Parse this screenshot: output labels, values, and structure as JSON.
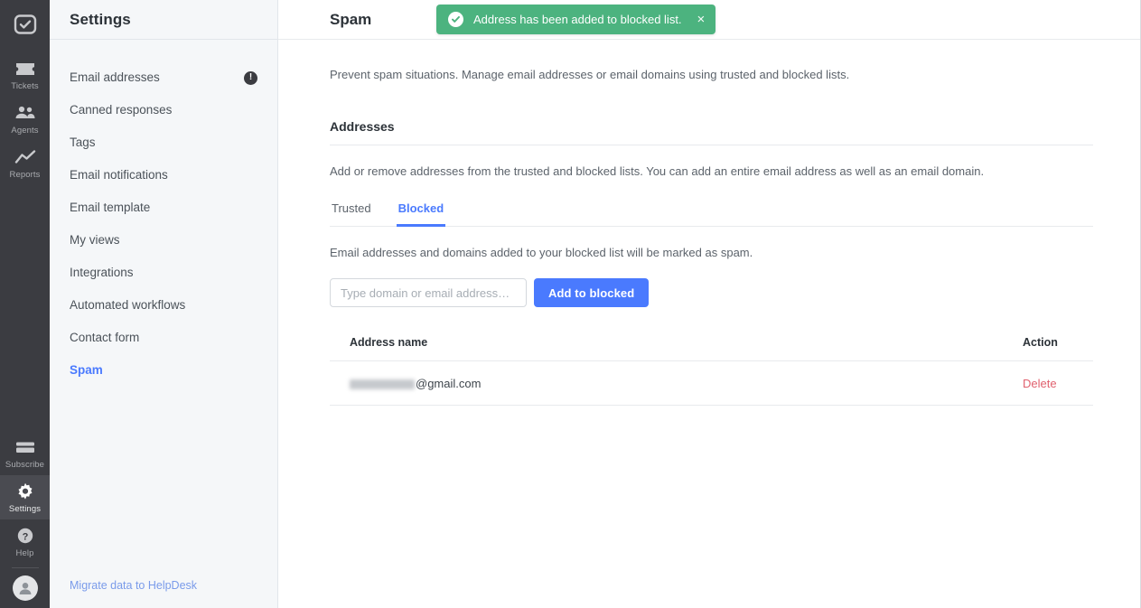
{
  "rail": {
    "logo_icon": "checkmark-square-logo",
    "items": [
      {
        "label": "Tickets",
        "icon": "ticket-icon",
        "active": false
      },
      {
        "label": "Agents",
        "icon": "agents-icon",
        "active": false
      },
      {
        "label": "Reports",
        "icon": "chart-line-icon",
        "active": false
      }
    ],
    "bottom_items": [
      {
        "label": "Subscribe",
        "icon": "credit-card-icon",
        "active": false
      },
      {
        "label": "Settings",
        "icon": "gear-icon",
        "active": true
      },
      {
        "label": "Help",
        "icon": "question-circle-icon",
        "active": false
      }
    ],
    "avatar_icon": "user-avatar-icon"
  },
  "settings": {
    "title": "Settings",
    "items": [
      {
        "label": "Email addresses",
        "badge": "!",
        "active": false
      },
      {
        "label": "Canned responses",
        "badge": null,
        "active": false
      },
      {
        "label": "Tags",
        "badge": null,
        "active": false
      },
      {
        "label": "Email notifications",
        "badge": null,
        "active": false
      },
      {
        "label": "Email template",
        "badge": null,
        "active": false
      },
      {
        "label": "My views",
        "badge": null,
        "active": false
      },
      {
        "label": "Integrations",
        "badge": null,
        "active": false
      },
      {
        "label": "Automated workflows",
        "badge": null,
        "active": false
      },
      {
        "label": "Contact form",
        "badge": null,
        "active": false
      },
      {
        "label": "Spam",
        "badge": null,
        "active": true
      }
    ],
    "migrate_link": "Migrate data to HelpDesk"
  },
  "toast": {
    "message": "Address has been added to blocked list.",
    "close_label": "×",
    "icon": "check-circle-icon",
    "color": "#4cb37f"
  },
  "page": {
    "title": "Spam",
    "intro": "Prevent spam situations. Manage email addresses or email domains using trusted and blocked lists.",
    "section_title": "Addresses",
    "section_desc": "Add or remove addresses from the trusted and blocked lists. You can add an entire email address as well as an email domain.",
    "tabs": [
      {
        "label": "Trusted",
        "active": false
      },
      {
        "label": "Blocked",
        "active": true
      }
    ],
    "tab_desc": "Email addresses and domains added to your blocked list will be marked as spam.",
    "input": {
      "value": "",
      "placeholder": "Type domain or email address…"
    },
    "add_button": "Add to blocked",
    "table": {
      "columns": [
        "Address name",
        "Action"
      ],
      "rows": [
        {
          "address_redacted": true,
          "address_suffix": "@gmail.com",
          "action": "Delete"
        }
      ]
    }
  },
  "colors": {
    "accent": "#4a7afe",
    "success": "#4cb37f",
    "danger": "#e0616e",
    "rail_bg": "#3b3c41",
    "panel_bg": "#f5f7f9"
  }
}
